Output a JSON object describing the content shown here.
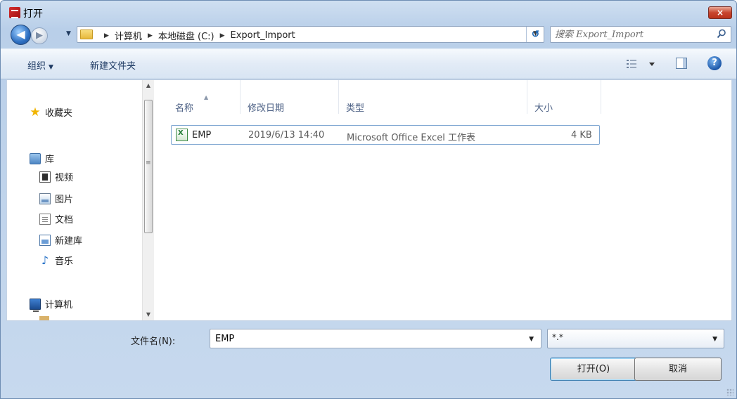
{
  "window": {
    "title": "打开",
    "close_label": "×"
  },
  "nav": {
    "back_symbol": "◀",
    "forward_symbol": "▶",
    "breadcrumbs": [
      "计算机",
      "本地磁盘 (C:)",
      "Export_Import"
    ],
    "refresh_symbol": "↺",
    "search_placeholder": "搜索 Export_Import"
  },
  "toolbar": {
    "organize_label": "组织",
    "new_folder_label": "新建文件夹"
  },
  "sidebar": {
    "items": [
      {
        "label": "收藏夹",
        "icon": "star-icon"
      },
      {
        "label": "库",
        "icon": "library-icon"
      },
      {
        "label": "视频",
        "icon": "video-icon"
      },
      {
        "label": "图片",
        "icon": "picture-icon"
      },
      {
        "label": "文档",
        "icon": "document-icon"
      },
      {
        "label": "新建库",
        "icon": "new-library-icon"
      },
      {
        "label": "音乐",
        "icon": "music-icon"
      },
      {
        "label": "计算机",
        "icon": "computer-icon"
      }
    ]
  },
  "columns": {
    "name": "名称",
    "modified": "修改日期",
    "type": "类型",
    "size": "大小"
  },
  "files": [
    {
      "name": "EMP",
      "modified": "2019/6/13 14:40",
      "type": "Microsoft Office Excel 工作表",
      "size": "4 KB",
      "icon": "excel-file-icon"
    }
  ],
  "footer": {
    "filename_label": "文件名(N):",
    "filename_value": "EMP",
    "filetype_value": "*.*",
    "open_label": "打开(O)",
    "cancel_label": "取消"
  },
  "colors": {
    "frame": "#c7d9ee",
    "close_button": "#c8452f",
    "header_text": "#4d6185"
  }
}
